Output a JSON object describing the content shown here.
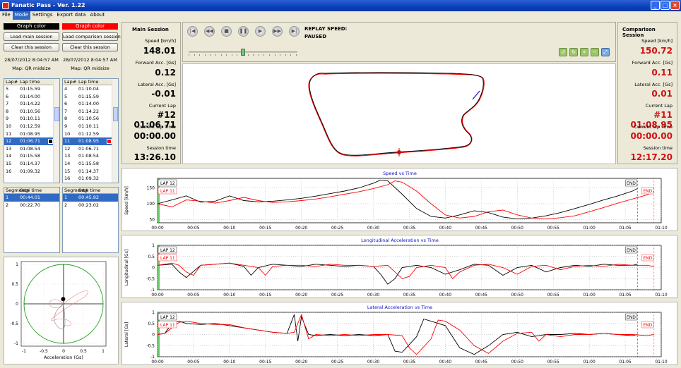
{
  "window": {
    "title": "Fanatic Pass - Ver. 1.22"
  },
  "menu": [
    "File",
    "Mode",
    "Settings",
    "Export data",
    "About"
  ],
  "left": {
    "main": {
      "color_label": "Graph color",
      "color": "#000000",
      "load_label": "Load main session",
      "clear_label": "Clear this session",
      "datetime": "28/07/2012 8:04:57 AM",
      "map": "Map: QR midsize"
    },
    "comp": {
      "color_label": "Graph color",
      "color": "#ff0000",
      "load_label": "Load comparison session",
      "clear_label": "Clear this session",
      "datetime": "28/07/2012 8:04:57 AM",
      "map": "Map: QR midsize"
    }
  },
  "lap_list_main": {
    "headers": [
      "Lap#",
      "Lap time"
    ],
    "rows": [
      [
        "5",
        "01:15.59"
      ],
      [
        "6",
        "01:14.00"
      ],
      [
        "7",
        "01:14.22"
      ],
      [
        "8",
        "01:10.56"
      ],
      [
        "9",
        "01:10.11"
      ],
      [
        "10",
        "01:12.59"
      ],
      [
        "11",
        "01:08.95"
      ],
      [
        "12",
        "01:06.71"
      ],
      [
        "13",
        "01:08.54"
      ],
      [
        "14",
        "01:15.58"
      ],
      [
        "15",
        "01:14.37"
      ],
      [
        "16",
        "01:09.32"
      ]
    ],
    "selected": 7
  },
  "lap_list_comp": {
    "headers": [
      "Lap#",
      "Lap time"
    ],
    "rows": [
      [
        "4",
        "01:10.04"
      ],
      [
        "5",
        "01:15.59"
      ],
      [
        "6",
        "01:14.00"
      ],
      [
        "7",
        "01:14.22"
      ],
      [
        "8",
        "01:10.56"
      ],
      [
        "9",
        "01:10.11"
      ],
      [
        "10",
        "01:12.59"
      ],
      [
        "11",
        "01:08.95"
      ],
      [
        "12",
        "01:06.71"
      ],
      [
        "13",
        "01:08.54"
      ],
      [
        "14",
        "01:15.58"
      ],
      [
        "15",
        "01:14.37"
      ],
      [
        "16",
        "01:09.32"
      ]
    ],
    "selected": 7
  },
  "seg_main": {
    "headers": [
      "Segment#",
      "Seg. time"
    ],
    "rows": [
      [
        "1",
        "00:44.01"
      ],
      [
        "2",
        "00:22.70"
      ]
    ],
    "selected": 0
  },
  "seg_comp": {
    "headers": [
      "Segment#",
      "Seg. time"
    ],
    "rows": [
      [
        "1",
        "00:45.92"
      ],
      [
        "2",
        "00:23.02"
      ]
    ],
    "selected": 0
  },
  "main_session": {
    "title": "Main Session",
    "speed_label": "Speed [km/h]",
    "speed": "148.01",
    "fwd_label": "Forward Acc. [Gs]",
    "fwd": "0.12",
    "lat_label": "Lateral Acc. [Gs]",
    "lat": "-0.01",
    "lap_label": "Current Lap",
    "lap": "#12 01:06.71",
    "laptime_label": "Current lap Time",
    "laptime": "00:00.00",
    "session_label": "Session time",
    "session": "13:26.10"
  },
  "comp_session": {
    "title": "Comparison Session",
    "speed_label": "Speed [km/h]",
    "speed": "150.72",
    "fwd_label": "Forward Acc. [Gs]",
    "fwd": "0.11",
    "lat_label": "Lateral Acc. [Gs]",
    "lat": "0.01",
    "lap_label": "Current Lap",
    "lap": "#11 01:08.95",
    "laptime_label": "Current lap Time",
    "laptime": "00:00.00",
    "session_label": "Session time",
    "session": "12:17.20"
  },
  "replay": {
    "speed_label": "REPLAY SPEED:",
    "status": "PAUSED",
    "controls": [
      "first-icon",
      "rewind-icon",
      "stop-icon",
      "pause-icon",
      "play-icon",
      "fast-forward-icon",
      "last-icon"
    ],
    "slider_fraction": 0.5
  },
  "colors": {
    "main": "#000000",
    "comp": "#ff0000",
    "title_blue": "#1010c0",
    "marker": "#00aa00"
  },
  "chart_data": [
    {
      "type": "line",
      "title": "Speed vs Time",
      "ylabel": "Speed [km/h]",
      "xlabel": "",
      "ylim": [
        40,
        180
      ],
      "yticks": [
        "150",
        "100",
        "50"
      ],
      "xticks": [
        "00:00",
        "00:05",
        "00:10",
        "00:15",
        "00:20",
        "00:25",
        "00:30",
        "00:35",
        "00:40",
        "00:45",
        "00:50",
        "00:55",
        "01:00",
        "01:05",
        "01:10"
      ],
      "legend": [
        "LAP 12",
        "LAP 11"
      ],
      "end_label": "END",
      "series": [
        {
          "name": "LAP 12",
          "x": [
            0,
            2,
            4,
            6,
            8,
            10,
            12,
            14,
            16,
            18,
            20,
            22,
            24,
            26,
            28,
            30,
            31,
            32,
            34,
            36,
            38,
            40,
            42,
            44,
            46,
            48,
            50,
            52,
            54,
            56,
            58,
            60,
            62,
            64,
            66,
            66.7
          ],
          "values": [
            100,
            112,
            125,
            105,
            108,
            125,
            110,
            106,
            108,
            112,
            117,
            124,
            132,
            140,
            150,
            165,
            175,
            172,
            130,
            85,
            60,
            55,
            65,
            78,
            72,
            58,
            52,
            55,
            62,
            72,
            85,
            98,
            112,
            125,
            140,
            148
          ]
        },
        {
          "name": "LAP 11",
          "x": [
            0,
            2,
            4,
            6,
            8,
            10,
            12,
            14,
            16,
            18,
            20,
            22,
            24,
            26,
            28,
            30,
            32,
            33,
            34,
            36,
            38,
            40,
            42,
            44,
            46,
            48,
            50,
            52,
            54,
            56,
            58,
            60,
            62,
            64,
            66,
            68,
            69
          ],
          "values": [
            100,
            90,
            112,
            108,
            102,
            110,
            120,
            110,
            104,
            106,
            110,
            115,
            122,
            130,
            138,
            148,
            160,
            172,
            168,
            140,
            100,
            65,
            55,
            60,
            75,
            80,
            65,
            55,
            52,
            56,
            62,
            75,
            88,
            102,
            115,
            128,
            138
          ]
        }
      ]
    },
    {
      "type": "line",
      "title": "Longitudinal Acceleration vs Time",
      "ylabel": "Longitudinal [Gs]",
      "xlabel": "",
      "ylim": [
        -1,
        1
      ],
      "yticks": [
        "1",
        "0.5",
        "0",
        "-0.5",
        "-1"
      ],
      "xticks": [
        "00:00",
        "00:05",
        "00:10",
        "00:15",
        "00:20",
        "00:25",
        "00:30",
        "00:35",
        "00:40",
        "00:45",
        "00:50",
        "00:55",
        "01:00",
        "01:05",
        "01:10"
      ],
      "legend": [
        "LAP 12",
        "LAP 11"
      ],
      "end_label": "END",
      "series": [
        {
          "name": "LAP 12",
          "x": [
            0,
            2,
            3,
            4,
            6,
            8,
            10,
            12,
            13,
            14,
            16,
            18,
            20,
            22,
            24,
            26,
            28,
            30,
            31,
            32,
            33,
            34,
            36,
            38,
            40,
            42,
            44,
            46,
            48,
            50,
            52,
            54,
            56,
            58,
            60,
            62,
            64,
            66,
            66.7
          ],
          "values": [
            0.1,
            0.15,
            -0.2,
            -0.45,
            0.1,
            0.15,
            0.2,
            0.05,
            -0.35,
            0.0,
            0.15,
            0.1,
            0.05,
            0.15,
            0.1,
            0.05,
            0.1,
            0.05,
            -0.3,
            -0.75,
            -0.5,
            0.0,
            0.1,
            0.0,
            -0.3,
            -0.1,
            0.15,
            0.1,
            -0.35,
            0.0,
            0.1,
            -0.2,
            0.0,
            0.1,
            0.05,
            0.15,
            0.1,
            0.1,
            0.15
          ]
        },
        {
          "name": "LAP 11",
          "x": [
            0,
            2,
            3,
            4,
            5,
            6,
            8,
            10,
            12,
            14,
            15,
            16,
            18,
            20,
            22,
            24,
            26,
            28,
            30,
            32,
            33,
            34,
            35,
            36,
            38,
            40,
            41,
            42,
            44,
            46,
            48,
            50,
            52,
            54,
            56,
            58,
            60,
            62,
            64,
            66,
            68,
            69
          ],
          "values": [
            0.1,
            0.2,
            0.1,
            -0.2,
            -0.35,
            0.1,
            0.15,
            0.2,
            0.1,
            0.0,
            -0.35,
            0.05,
            0.1,
            0.1,
            0.05,
            0.15,
            0.1,
            0.1,
            0.05,
            0.1,
            -0.2,
            -0.5,
            -0.4,
            0.0,
            0.1,
            0.0,
            -0.5,
            -0.2,
            0.1,
            0.15,
            0.0,
            -0.3,
            0.05,
            0.1,
            -0.1,
            0.05,
            0.1,
            0.05,
            0.15,
            0.1,
            0.1,
            0.05
          ]
        }
      ]
    },
    {
      "type": "line",
      "title": "Lateral Acceleration vs Time",
      "ylabel": "Lateral [Gs]",
      "xlabel": "",
      "ylim": [
        -1,
        1
      ],
      "yticks": [
        "1",
        "0.5",
        "0",
        "-0.5",
        "-1"
      ],
      "xticks": [
        "00:00",
        "00:05",
        "00:10",
        "00:15",
        "00:20",
        "00:25",
        "00:30",
        "00:35",
        "00:40",
        "00:45",
        "00:50",
        "00:55",
        "01:00",
        "01:05",
        "01:10"
      ],
      "legend": [
        "LAP 12",
        "LAP 11"
      ],
      "end_label": "END",
      "series": [
        {
          "name": "LAP 12",
          "x": [
            0,
            1,
            2,
            3,
            4,
            6,
            8,
            10,
            12,
            14,
            16,
            18,
            19,
            19.5,
            20,
            21,
            22,
            24,
            26,
            28,
            30,
            32,
            33,
            34,
            36,
            37,
            38,
            40,
            42,
            44,
            46,
            48,
            50,
            52,
            54,
            56,
            58,
            60,
            62,
            64,
            66,
            66.7
          ],
          "values": [
            0.0,
            0.05,
            0.5,
            0.6,
            0.5,
            0.45,
            0.5,
            0.4,
            0.3,
            0.2,
            0.1,
            0.05,
            0.9,
            -0.3,
            0.8,
            0.0,
            -0.05,
            0.0,
            -0.05,
            0.0,
            -0.05,
            0.0,
            -0.75,
            -0.8,
            -0.1,
            0.7,
            0.6,
            0.4,
            -0.6,
            -0.9,
            -0.5,
            0.0,
            0.1,
            -0.1,
            0.0,
            0.0,
            0.05,
            0.0,
            0.05,
            0.0,
            -0.05,
            0.0
          ]
        },
        {
          "name": "LAP 11",
          "x": [
            0,
            1,
            2,
            3,
            4,
            6,
            8,
            10,
            12,
            14,
            16,
            18,
            19,
            20,
            21,
            22,
            24,
            26,
            28,
            30,
            32,
            34,
            35,
            36,
            38,
            39,
            40,
            42,
            44,
            46,
            48,
            50,
            52,
            53,
            54,
            56,
            58,
            60,
            62,
            64,
            66,
            68,
            69
          ],
          "values": [
            0.0,
            0.05,
            0.3,
            0.55,
            0.6,
            0.5,
            0.45,
            0.45,
            0.3,
            0.2,
            0.1,
            0.05,
            0.1,
            0.9,
            -0.2,
            0.0,
            -0.05,
            0.0,
            -0.05,
            0.0,
            0.0,
            -0.05,
            -0.6,
            -0.9,
            -0.2,
            0.65,
            0.6,
            0.2,
            -0.5,
            -0.85,
            -0.3,
            0.05,
            0.1,
            -0.3,
            0.0,
            -0.1,
            0.0,
            0.0,
            0.05,
            0.0,
            0.0,
            -0.05,
            0.0
          ]
        }
      ]
    },
    {
      "type": "scatter",
      "title": "",
      "xlabel": "Acceleration (Gs)",
      "ylabel": "",
      "xlim": [
        -1,
        1
      ],
      "ylim": [
        -1,
        1
      ],
      "xticks": [
        "-1",
        "-0.5",
        "0",
        "0.5",
        "1"
      ],
      "yticks": [
        "1",
        "0.5",
        "0",
        "-0.5",
        "-1"
      ],
      "current_point": [
        -0.01,
        0.12
      ]
    }
  ]
}
